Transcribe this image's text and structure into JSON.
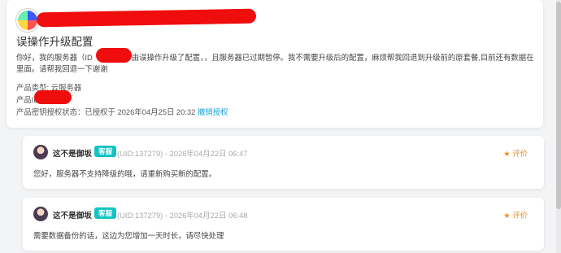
{
  "ticket": {
    "title": "误操作升级配置",
    "body_pre": "你好，我的服务器（ID",
    "body_post": "由误操作升级了配置，，且服务器已过期暂停。我不需要升级后的配置，麻烦帮我回退到升级前的原套餐,目前还有数据在里面。请帮我回退一下谢谢",
    "product_type_label": "产品类型: ",
    "product_type_value": "云服务器",
    "product_id_label": "产品ID",
    "auth_label": "产品密钥授权状态：",
    "auth_value": "已授权于 2026年04月25日 20:32",
    "auth_link": "撤销授权"
  },
  "replies": [
    {
      "name": "这不是御坂",
      "badge": "客服",
      "meta": "(UID:137279) - 2026年04月22日 06:47",
      "rate_label": "评价",
      "text": "您好，服务器不支持降级的哦，请重新购买新的配置。"
    },
    {
      "name": "这不是御坂",
      "badge": "客服",
      "meta": "(UID:137279) - 2026年04月22日 06:48",
      "rate_label": "评价",
      "text": "需要数据备份的话，这边为您增加一天时长，请尽快处理"
    }
  ],
  "colors": {
    "accent": "#13c2c2",
    "link": "#16a3d9",
    "rate": "#f08c1b",
    "redaction": "#f00d0d"
  }
}
